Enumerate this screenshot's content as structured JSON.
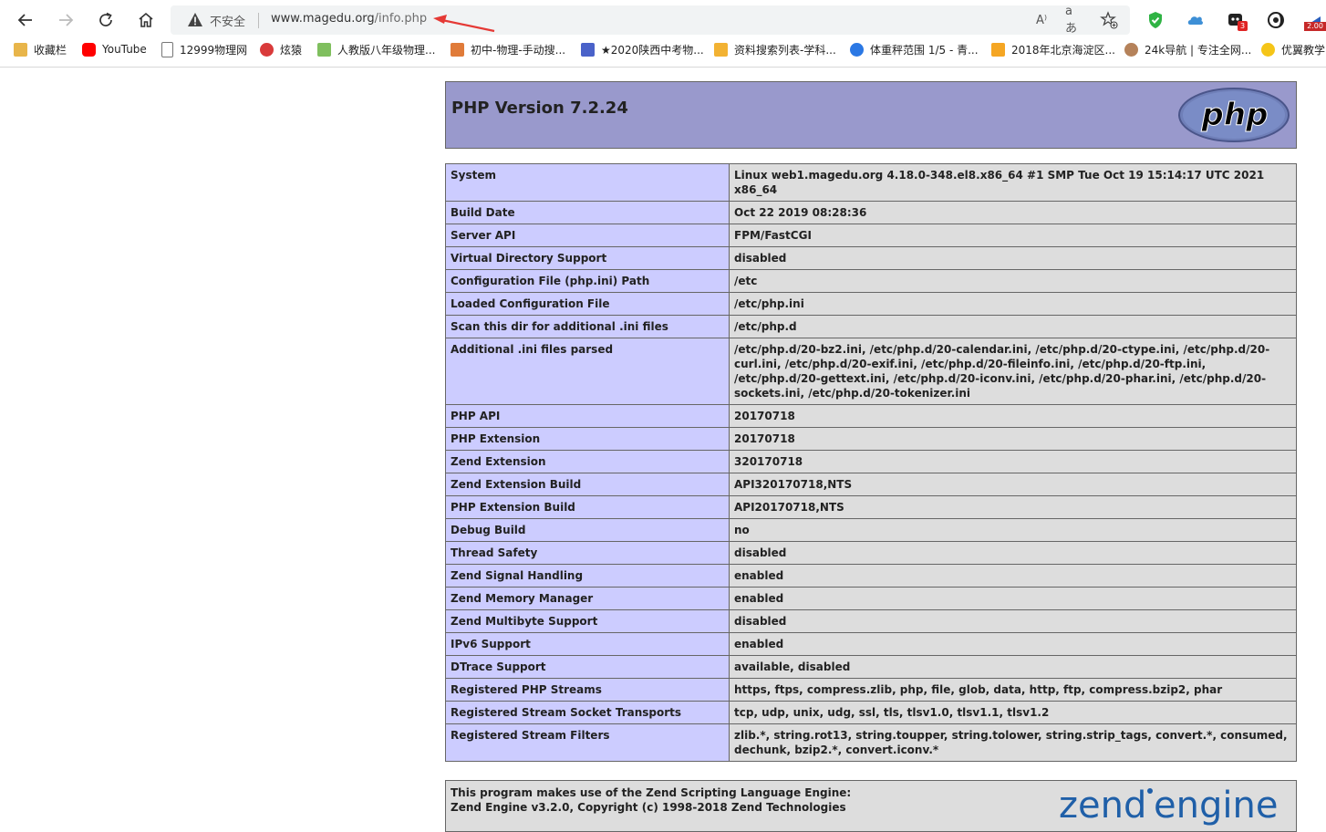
{
  "browser": {
    "security_label": "不安全",
    "url_host": "www.magedu.org",
    "url_path": "/info.php",
    "read_aloud_glyph": "A⁾",
    "translate_glyph": "aあ",
    "ext_badge_count": "3",
    "ext_speed_label": "2.00",
    "nav_icons": [
      "back-icon",
      "forward-icon",
      "reload-icon",
      "home-icon"
    ],
    "annotation_color": "#e53935"
  },
  "bookmarks": [
    {
      "label": "收藏栏",
      "color": "#e8b54a"
    },
    {
      "label": "YouTube",
      "color": "#ff0000"
    },
    {
      "label": "12999物理网",
      "color": "#777777"
    },
    {
      "label": "炫猿",
      "color": "#d93a3a"
    },
    {
      "label": "人教版八年级物理...",
      "color": "#7fbf5e"
    },
    {
      "label": "初中-物理-手动搜...",
      "color": "#e07b39"
    },
    {
      "label": "★2020陕西中考物...",
      "color": "#4a62c9"
    },
    {
      "label": "资料搜索列表-学科...",
      "color": "#f2b233"
    },
    {
      "label": "体重秤范围 1/5 - 青...",
      "color": "#2b78e4"
    },
    {
      "label": "2018年北京海淀区...",
      "color": "#f5a623"
    },
    {
      "label": "24k导航 | 专注全网...",
      "color": "#b5825a"
    },
    {
      "label": "优翼教学",
      "color": "#f5c518"
    }
  ],
  "phpinfo": {
    "title": "PHP Version 7.2.24",
    "logo_text": "php",
    "rows": [
      {
        "key": "System",
        "value": "Linux web1.magedu.org 4.18.0-348.el8.x86_64 #1 SMP Tue Oct 19 15:14:17 UTC 2021 x86_64"
      },
      {
        "key": "Build Date",
        "value": "Oct 22 2019 08:28:36"
      },
      {
        "key": "Server API",
        "value": "FPM/FastCGI"
      },
      {
        "key": "Virtual Directory Support",
        "value": "disabled"
      },
      {
        "key": "Configuration File (php.ini) Path",
        "value": "/etc"
      },
      {
        "key": "Loaded Configuration File",
        "value": "/etc/php.ini"
      },
      {
        "key": "Scan this dir for additional .ini files",
        "value": "/etc/php.d"
      },
      {
        "key": "Additional .ini files parsed",
        "value": "/etc/php.d/20-bz2.ini, /etc/php.d/20-calendar.ini, /etc/php.d/20-ctype.ini, /etc/php.d/20-curl.ini, /etc/php.d/20-exif.ini, /etc/php.d/20-fileinfo.ini, /etc/php.d/20-ftp.ini, /etc/php.d/20-gettext.ini, /etc/php.d/20-iconv.ini, /etc/php.d/20-phar.ini, /etc/php.d/20-sockets.ini, /etc/php.d/20-tokenizer.ini"
      },
      {
        "key": "PHP API",
        "value": "20170718"
      },
      {
        "key": "PHP Extension",
        "value": "20170718"
      },
      {
        "key": "Zend Extension",
        "value": "320170718"
      },
      {
        "key": "Zend Extension Build",
        "value": "API320170718,NTS"
      },
      {
        "key": "PHP Extension Build",
        "value": "API20170718,NTS"
      },
      {
        "key": "Debug Build",
        "value": "no"
      },
      {
        "key": "Thread Safety",
        "value": "disabled"
      },
      {
        "key": "Zend Signal Handling",
        "value": "enabled"
      },
      {
        "key": "Zend Memory Manager",
        "value": "enabled"
      },
      {
        "key": "Zend Multibyte Support",
        "value": "disabled"
      },
      {
        "key": "IPv6 Support",
        "value": "enabled"
      },
      {
        "key": "DTrace Support",
        "value": "available, disabled"
      },
      {
        "key": "Registered PHP Streams",
        "value": "https, ftps, compress.zlib, php, file, glob, data, http, ftp, compress.bzip2, phar"
      },
      {
        "key": "Registered Stream Socket Transports",
        "value": "tcp, udp, unix, udg, ssl, tls, tlsv1.0, tlsv1.1, tlsv1.2"
      },
      {
        "key": "Registered Stream Filters",
        "value": "zlib.*, string.rot13, string.toupper, string.tolower, string.strip_tags, convert.*, consumed, dechunk, bzip2.*, convert.iconv.*"
      }
    ],
    "zend_line1": "This program makes use of the Zend Scripting Language Engine:",
    "zend_line2": "Zend Engine v3.2.0, Copyright (c) 1998-2018 Zend Technologies",
    "zend_logo_word1": "zend",
    "zend_logo_word2": "engine"
  }
}
